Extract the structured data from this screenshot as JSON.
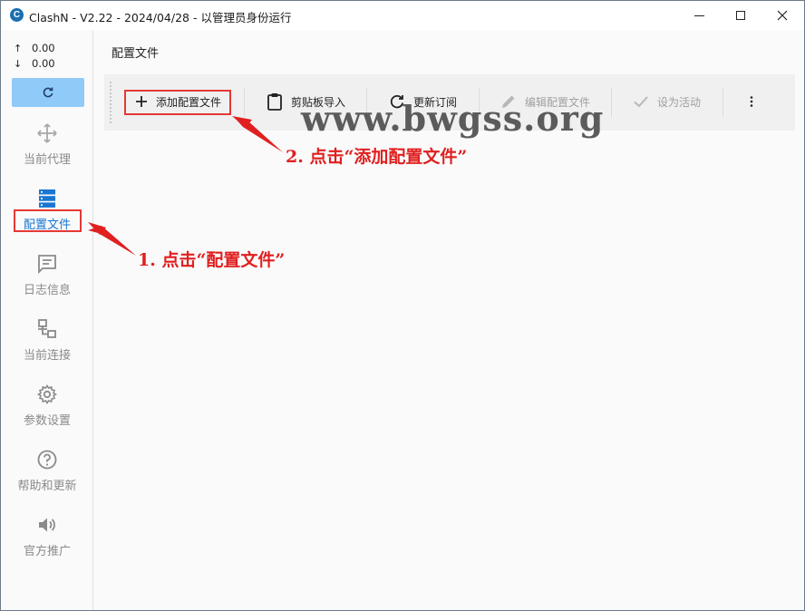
{
  "window": {
    "logo_letter": "C",
    "title": "ClashN - V2.22 - 2024/04/28 - 以管理员身份运行"
  },
  "sidebar": {
    "upload_speed": "0.00",
    "download_speed": "0.00",
    "upload_arrow": "↑",
    "download_arrow": "↓",
    "items": [
      {
        "label": "当前代理",
        "icon": "proxy-icon"
      },
      {
        "label": "配置文件",
        "icon": "profiles-icon",
        "active": true
      },
      {
        "label": "日志信息",
        "icon": "log-icon"
      },
      {
        "label": "当前连接",
        "icon": "connections-icon"
      },
      {
        "label": "参数设置",
        "icon": "gear-icon"
      },
      {
        "label": "帮助和更新",
        "icon": "help-icon"
      },
      {
        "label": "官方推广",
        "icon": "speaker-icon"
      }
    ]
  },
  "main": {
    "page_title": "配置文件",
    "toolbar": {
      "add_profile": "添加配置文件",
      "clipboard_import": "剪贴板导入",
      "update_subscription": "更新订阅",
      "edit_profile": "编辑配置文件",
      "set_active": "设为活动"
    }
  },
  "annotations": {
    "step1": "1. 点击“配置文件”",
    "step2": "2. 点击“添加配置文件”",
    "watermark": "www.bwgss.org"
  },
  "colors": {
    "accent": "#1976d2",
    "refresh_button": "#90caf9",
    "annotation_red": "#e02020"
  }
}
